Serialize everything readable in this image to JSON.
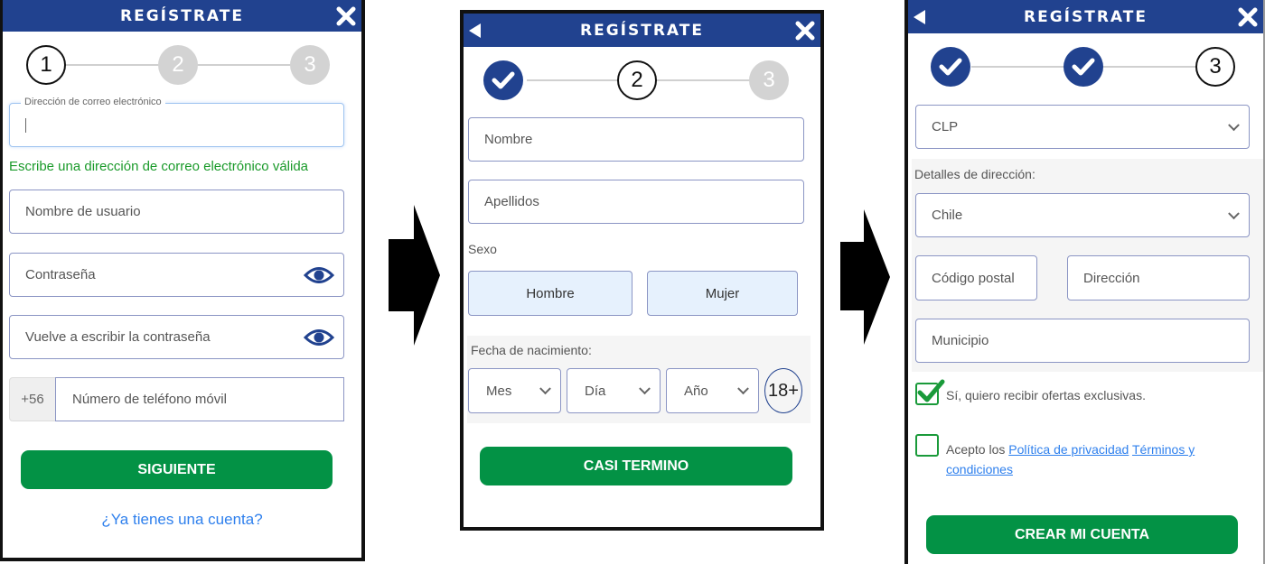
{
  "colors": {
    "header": "#21428f",
    "green": "#039245",
    "link": "#2f80ed",
    "valid_text": "#1a9a2a"
  },
  "step1": {
    "title": "REGÍSTRATE",
    "steps": [
      "1",
      "2",
      "3"
    ],
    "email": {
      "label": "Dirección de correo electrónico",
      "value": ""
    },
    "email_hint": "Escribe una dirección de correo electrónico válida",
    "username_placeholder": "Nombre de usuario",
    "password_placeholder": "Contraseña",
    "password_repeat_placeholder": "Vuelve a escribir la contraseña",
    "phone_prefix": "+56",
    "phone_placeholder": "Número de teléfono móvil",
    "next_button": "SIGUIENTE",
    "login_link": "¿Ya tienes una cuenta?"
  },
  "step2": {
    "title": "REGÍSTRATE",
    "steps": [
      "✓",
      "2",
      "3"
    ],
    "first_name_placeholder": "Nombre",
    "last_name_placeholder": "Apellidos",
    "sex_label": "Sexo",
    "sex_options": [
      "Hombre",
      "Mujer"
    ],
    "dob_label": "Fecha de nacimiento:",
    "dob_month": "Mes",
    "dob_day": "Día",
    "dob_year": "Año",
    "age_badge": "18+",
    "next_button": "CASI TERMINO"
  },
  "step3": {
    "title": "REGÍSTRATE",
    "steps": [
      "✓",
      "✓",
      "3"
    ],
    "currency": "CLP",
    "address_label": "Detalles de dirección:",
    "country": "Chile",
    "postal_placeholder": "Código postal",
    "address_placeholder": "Dirección",
    "city_placeholder": "Municipio",
    "offers_checkbox": {
      "label": "Sí, quiero recibir ofertas exclusivas.",
      "checked": true
    },
    "terms_checkbox": {
      "prefix": "Acepto los ",
      "privacy_link": "Política de privacidad",
      "terms_link_1": "Términos y",
      "terms_link_2": "condiciones",
      "checked": false
    },
    "submit_button": "CREAR MI CUENTA"
  }
}
